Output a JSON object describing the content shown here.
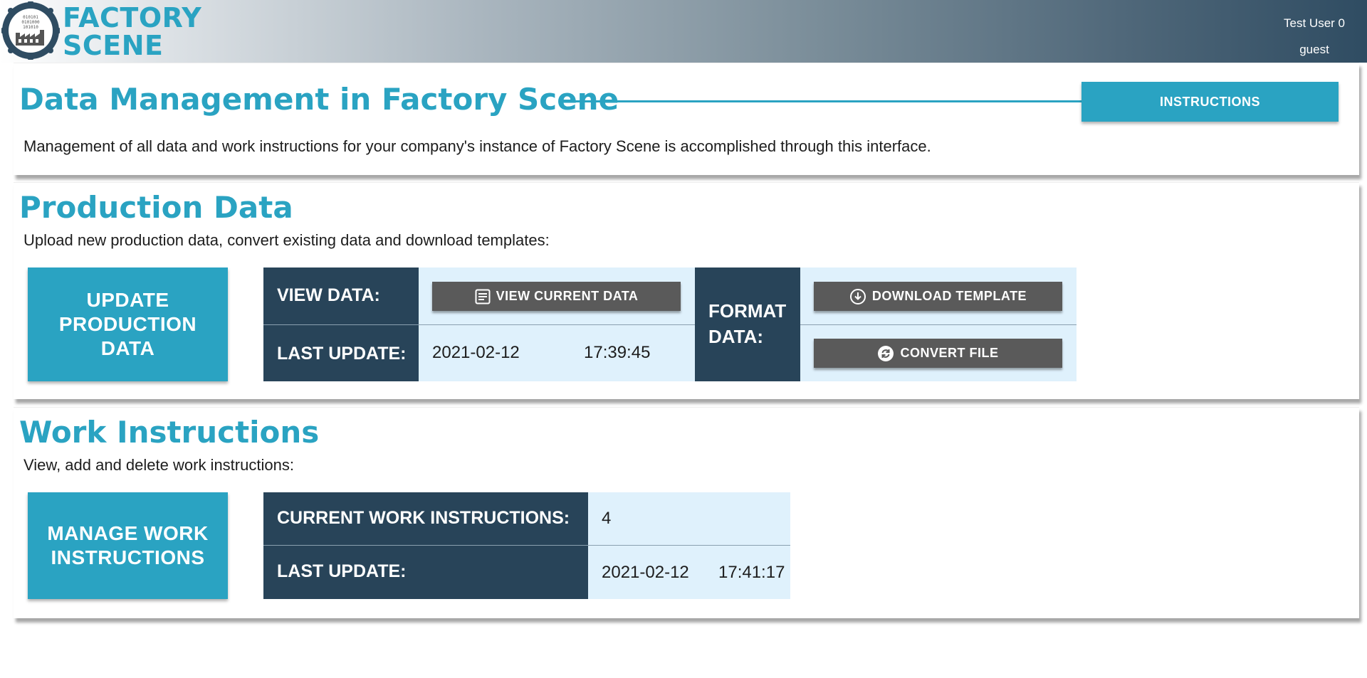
{
  "header": {
    "brand_line1": "FACTORY",
    "brand_line2": "SCENE",
    "logo_text": "010101 0101000 101010",
    "user_name": "Test User 0",
    "user_role": "guest"
  },
  "intro": {
    "title": "Data Management in Factory Scene",
    "instructions_label": "INSTRUCTIONS",
    "description": "Management of all data and work instructions for your company's instance of Factory Scene is accomplished through this interface."
  },
  "production": {
    "title": "Production Data",
    "description": "Upload new production data, convert existing data and download templates:",
    "update_button_label": "UPDATE PRODUCTION DATA",
    "view_data_label": "VIEW DATA:",
    "view_current_data_label": "VIEW CURRENT DATA",
    "last_update_label": "LAST UPDATE:",
    "last_update_date": "2021-02-12",
    "last_update_time": "17:39:45",
    "format_data_label": "FORMAT DATA:",
    "download_template_label": "DOWNLOAD TEMPLATE",
    "convert_file_label": "CONVERT FILE"
  },
  "work": {
    "title": "Work Instructions",
    "description": "View, add and delete work instructions:",
    "manage_button_label": "MANAGE WORK INSTRUCTIONS",
    "current_label": "CURRENT WORK INSTRUCTIONS:",
    "current_count": "4",
    "last_update_label": "LAST UPDATE:",
    "last_update_date": "2021-02-12",
    "last_update_time": "17:41:17"
  },
  "colors": {
    "accent": "#2aa3c2",
    "dark_cell": "#284459",
    "light_cell": "#dff1fc",
    "gray_button": "#5a5a5a"
  },
  "icons": [
    "factory-logo-icon",
    "document-icon",
    "download-circle-icon",
    "refresh-circle-icon"
  ]
}
